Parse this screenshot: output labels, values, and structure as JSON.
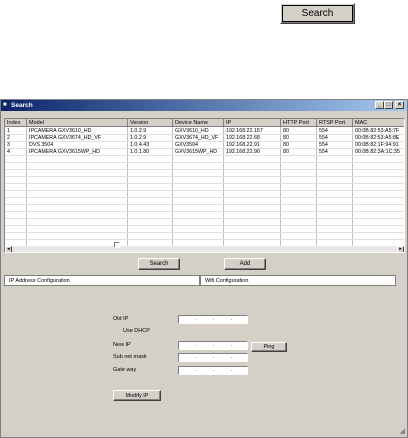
{
  "top_search_label": "Search",
  "window": {
    "title": "Search",
    "controls": {
      "minimize": "_",
      "maximize": "□",
      "close": "×"
    }
  },
  "table": {
    "headers": [
      "Index",
      "Model",
      "Version",
      "Device Name",
      "IP",
      "HTTP Port",
      "RTSP Port",
      "MAC"
    ],
    "rows": [
      [
        "1",
        "IPCAMERA GXV3610_HD",
        "1.0.2.9",
        "GXV3610_HD",
        "192.168.22.157",
        "80",
        "554",
        "00:0B:82:53:A5:7F"
      ],
      [
        "2",
        "IPCAMERA GXV3674_HD_VF",
        "1.0.2.9",
        "GXV3674_HD_VF",
        "192.168.22.68",
        "80",
        "554",
        "00:0B:82:53:A5:8E"
      ],
      [
        "3",
        "DVS 3504",
        "1.0.4.43",
        "GXV3504",
        "192.168.22.91",
        "80",
        "554",
        "00:0B:82:1F:94:91"
      ],
      [
        "4",
        "IPCAMERA GXV3615WP_HD",
        "1.0.1.80",
        "GXV3615WP_HD",
        "192.168.22.90",
        "80",
        "554",
        "00:0B:82:3A:1C:35"
      ]
    ]
  },
  "buttons": {
    "search": "Search",
    "add": "Add",
    "ping": "Ping",
    "modify_ip": "Modify IP"
  },
  "tabs": {
    "ip_config": "IP Address Configuration",
    "wifi_config": "Wifi Configuration"
  },
  "form": {
    "old_ip_label": "Old IP",
    "use_dhcp_label": "Use DHCP",
    "new_ip_label": "New IP",
    "subnet_label": "Sub net mask",
    "gateway_label": "Gate way",
    "ip_separator": "."
  }
}
